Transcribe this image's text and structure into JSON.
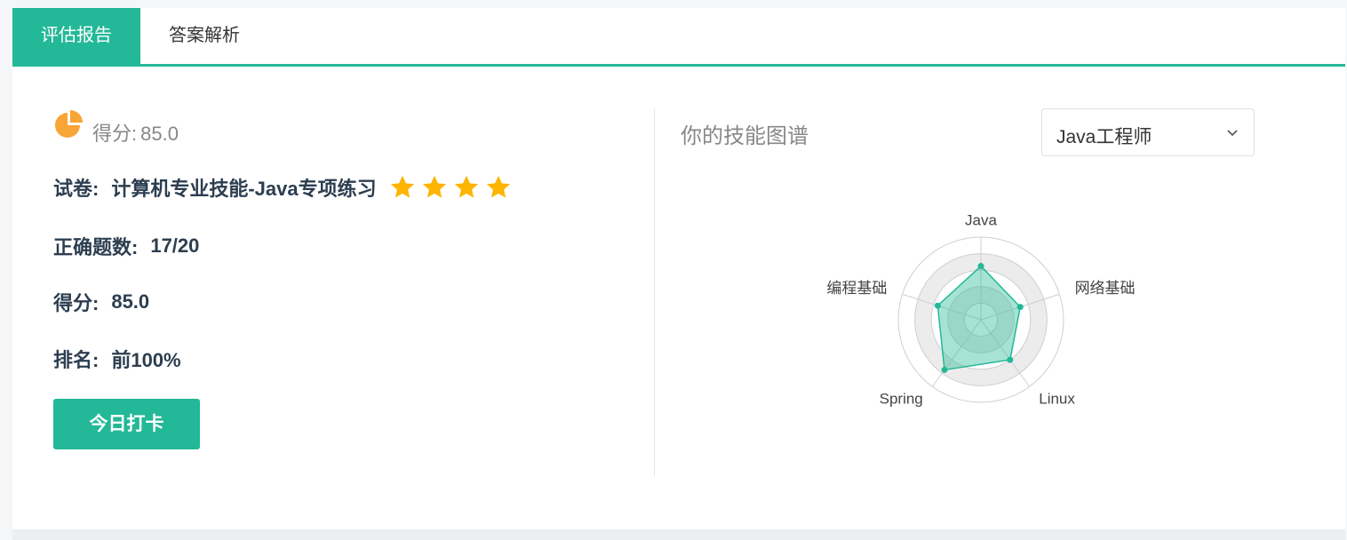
{
  "tabs": [
    {
      "label": "评估报告",
      "active": true
    },
    {
      "label": "答案解析",
      "active": false
    }
  ],
  "summary": {
    "score_label": "得分:",
    "score_value": "85.0"
  },
  "details": {
    "paper_label": "试卷:",
    "paper_value": "计算机专业技能-Java专项练习",
    "stars": 4,
    "correct_label": "正确题数:",
    "correct_value": "17/20",
    "score_label": "得分:",
    "score_value": "85.0",
    "rank_label": "排名:",
    "rank_value": "前100%"
  },
  "checkin_button": "今日打卡",
  "skills": {
    "title": "你的技能图谱",
    "role_selected": "Java工程师"
  },
  "icons": {
    "summary": "pie-chart-icon",
    "rating": "star-icon",
    "dropdown": "chevron-down-icon"
  },
  "colors": {
    "accent": "#23b897",
    "star": "#ffb400",
    "pie": "#f7a534"
  },
  "chart_data": {
    "type": "radar",
    "indicators": [
      "Java",
      "网络基础",
      "Linux",
      "Spring",
      "编程基础"
    ],
    "max": 100,
    "values": [
      65,
      50,
      60,
      75,
      55
    ]
  }
}
